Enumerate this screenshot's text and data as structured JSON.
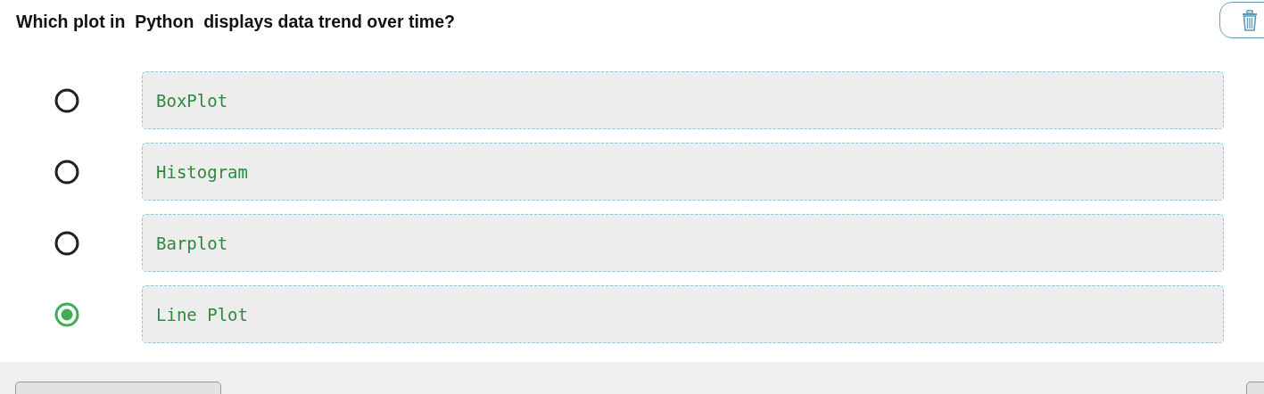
{
  "question": "Which plot in  Python  displays data trend over time?",
  "options": [
    {
      "label": "BoxPlot",
      "selected": false
    },
    {
      "label": "Histogram",
      "selected": false
    },
    {
      "label": "Barplot",
      "selected": false
    },
    {
      "label": "Line Plot",
      "selected": true
    }
  ]
}
